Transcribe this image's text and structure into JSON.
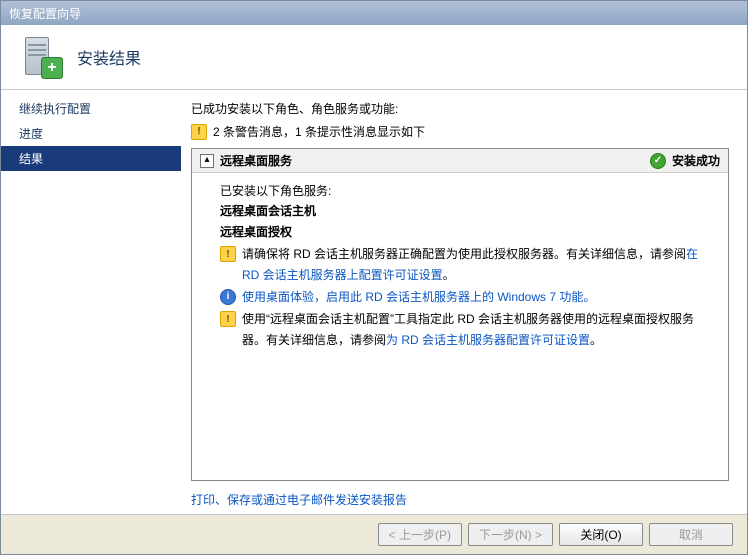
{
  "titlebar": {
    "title": "恢复配置向导"
  },
  "header": {
    "heading": "安装结果"
  },
  "sidebar": {
    "items": [
      {
        "label": "继续执行配置"
      },
      {
        "label": "进度"
      },
      {
        "label": "结果"
      }
    ]
  },
  "content": {
    "intro": "已成功安装以下角色、角色服务或功能:",
    "summary": "2 条警告消息，1 条提示性消息显示如下",
    "role": {
      "name": "远程桌面服务",
      "status": "安装成功",
      "services_label": "已安装以下角色服务:",
      "services": [
        "远程桌面会话主机",
        "远程桌面授权"
      ],
      "messages": [
        {
          "type": "warning",
          "pre": "请确保将 RD 会话主机服务器正确配置为使用此授权服务器。有关详细信息，请参阅",
          "link": "在 RD 会话主机服务器上配置许可证设置",
          "post": "。"
        },
        {
          "type": "info",
          "pre": "",
          "link": "使用桌面体验，启用此 RD 会话主机服务器上的 Windows 7 功能。",
          "post": ""
        },
        {
          "type": "warning",
          "pre": "使用“远程桌面会话主机配置”工具指定此 RD 会话主机服务器使用的远程桌面授权服务器。有关详细信息，请参阅",
          "link": "为 RD 会话主机服务器配置许可证设置",
          "post": "。"
        }
      ]
    },
    "report_link": "打印、保存或通过电子邮件发送安装报告"
  },
  "buttons": {
    "back": "< 上一步(P)",
    "next": "下一步(N) >",
    "close": "关闭(O)",
    "cancel": "取消"
  }
}
